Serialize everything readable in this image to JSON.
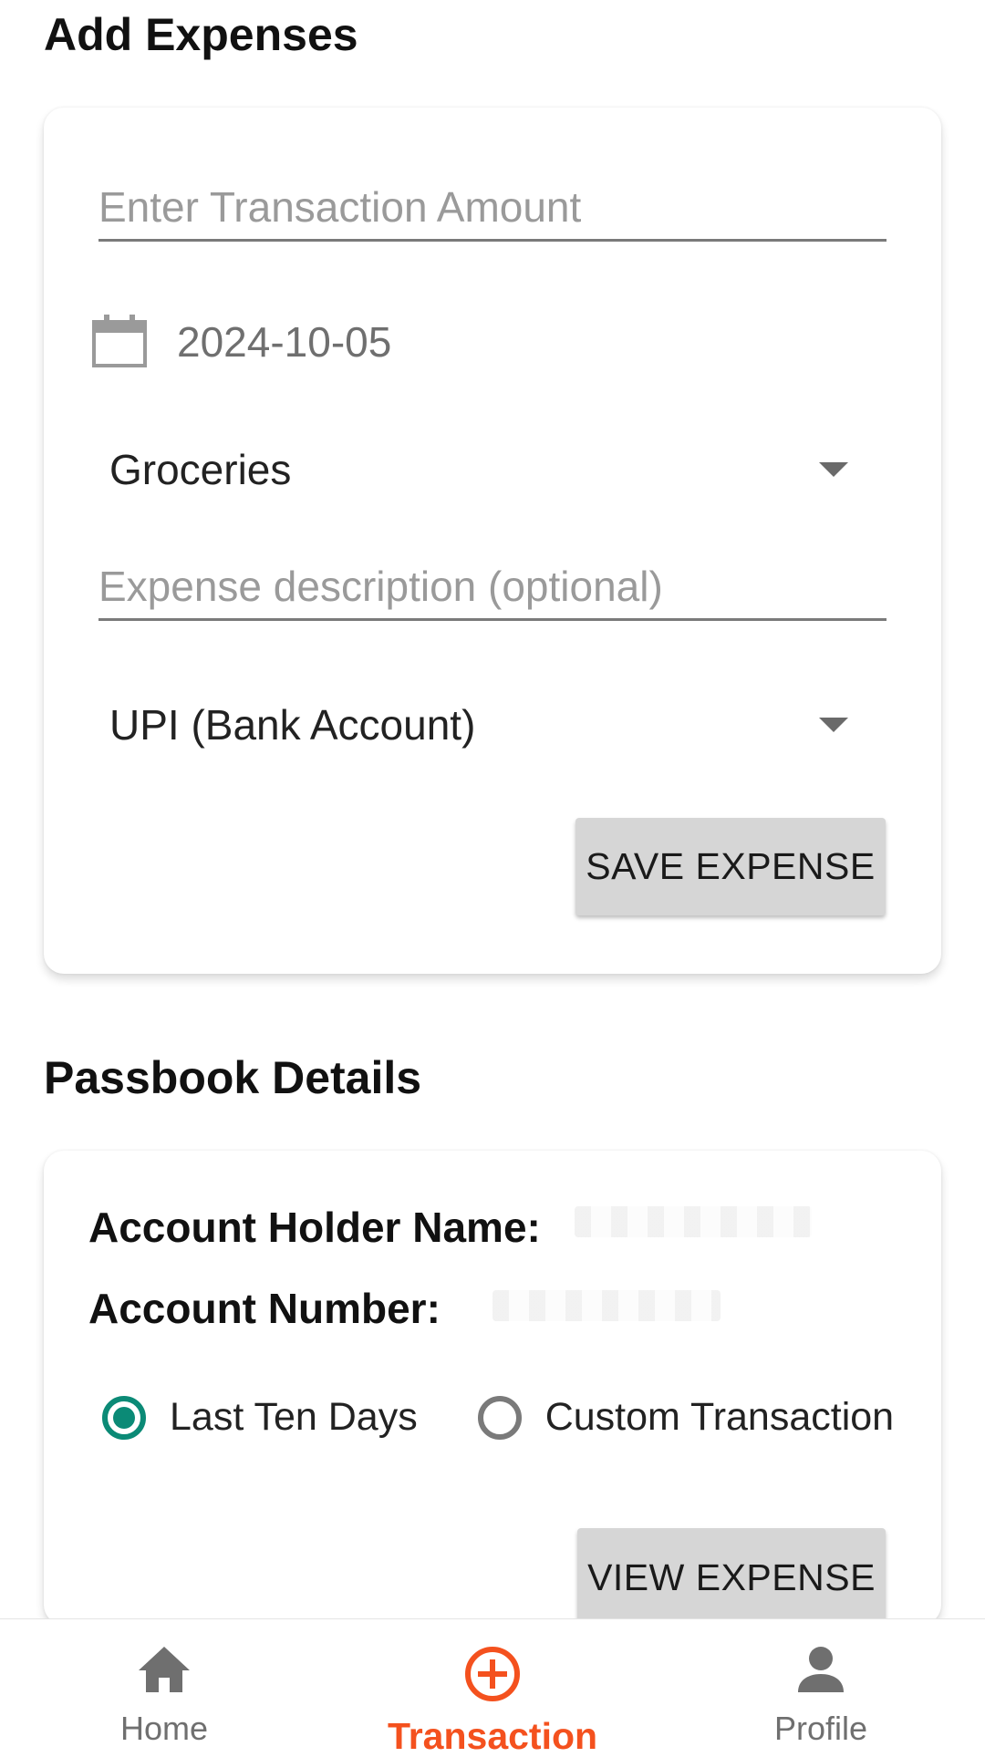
{
  "add_expenses": {
    "title": "Add Expenses",
    "amount_placeholder": "Enter Transaction Amount",
    "date_value": "2024-10-05",
    "category_selected": "Groceries",
    "description_placeholder": "Expense description (optional)",
    "payment_method_selected": "UPI (Bank Account)",
    "save_button_label": "SAVE EXPENSE"
  },
  "passbook": {
    "title": "Passbook Details",
    "account_holder_label": "Account Holder Name:",
    "account_number_label": "Account Number:",
    "radio_options": [
      {
        "label": "Last Ten Days",
        "checked": true
      },
      {
        "label": "Custom Transaction",
        "checked": false
      }
    ],
    "view_button_label": "VIEW EXPENSE"
  },
  "bottom_nav": {
    "items": [
      {
        "label": "Home",
        "icon": "home-icon",
        "active": false
      },
      {
        "label": "Transaction",
        "icon": "add-circle-icon",
        "active": true
      },
      {
        "label": "Profile",
        "icon": "person-icon",
        "active": false
      }
    ]
  },
  "colors": {
    "accent": "#f4511e",
    "radio_checked": "#0b8a76",
    "button_bg": "#d6d6d6"
  }
}
